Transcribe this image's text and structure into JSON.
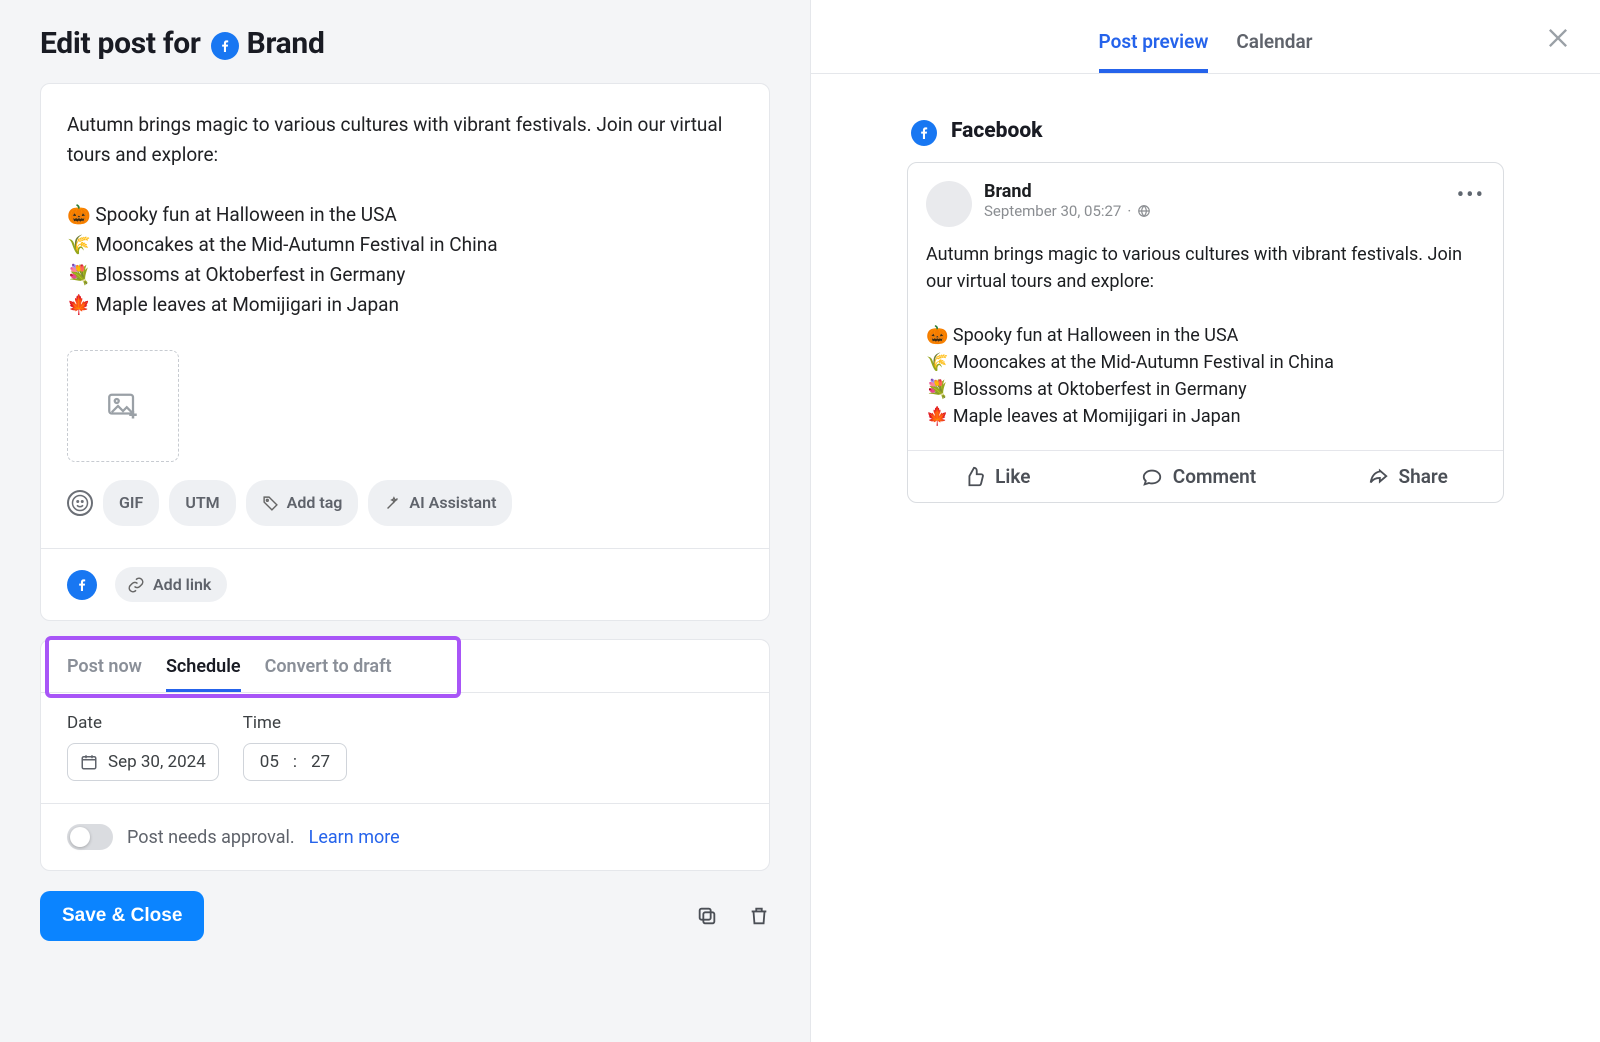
{
  "page": {
    "title_prefix": "Edit post for",
    "brand_name": "Brand"
  },
  "composer": {
    "text": "Autumn brings magic to various cultures with vibrant festivals. Join our virtual tours and explore:\n\n🎃 Spooky fun at Halloween in the USA\n🌾 Mooncakes at the Mid-Autumn Festival in China\n💐 Blossoms at Oktoberfest in Germany\n🍁 Maple leaves at Momijigari in Japan",
    "tools": {
      "gif": "GIF",
      "utm": "UTM",
      "add_tag": "Add tag",
      "ai_assistant": "AI Assistant"
    },
    "add_link": "Add link"
  },
  "publish_tabs": {
    "post_now": "Post now",
    "schedule": "Schedule",
    "convert": "Convert to draft"
  },
  "schedule": {
    "date_label": "Date",
    "time_label": "Time",
    "date_value": "Sep 30, 2024",
    "time_hh": "05",
    "time_mm": "27"
  },
  "approval": {
    "text": "Post needs approval.",
    "link": "Learn more"
  },
  "actions": {
    "save_close": "Save & Close"
  },
  "right_tabs": {
    "preview": "Post preview",
    "calendar": "Calendar"
  },
  "preview": {
    "network": "Facebook",
    "author": "Brand",
    "timestamp": "September 30, 05:27",
    "body": "Autumn brings magic to various cultures with vibrant festivals. Join our virtual tours and explore:\n\n🎃 Spooky fun at Halloween in the USA\n🌾 Mooncakes at the Mid-Autumn Festival in China\n💐 Blossoms at Oktoberfest in Germany\n🍁 Maple leaves at Momijigari in Japan",
    "actions": {
      "like": "Like",
      "comment": "Comment",
      "share": "Share"
    }
  }
}
